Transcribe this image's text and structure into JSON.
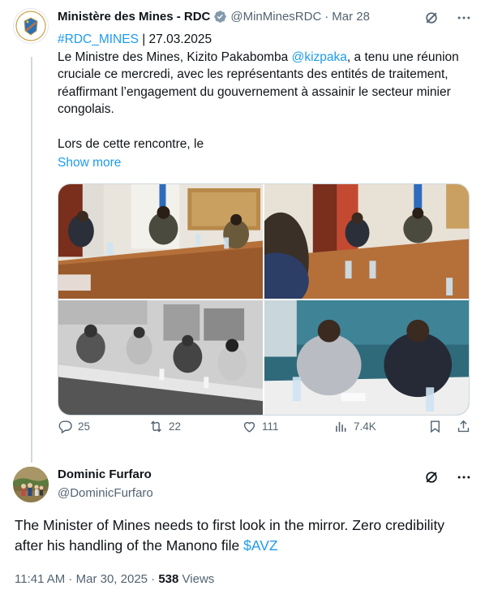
{
  "tweet": {
    "author_name": "Ministère des Mines - RDC",
    "author_handle": "@MinMinesRDC",
    "date": "Mar 28",
    "hashtag": "#RDC_MINES",
    "date_tag": " | 27.03.2025",
    "text_part1": "Le Ministre des Mines, Kizito Pakabomba ",
    "mention": "@kizpaka",
    "text_part2": ", a tenu une réunion cruciale ce mercredi, avec les représentants des entités de traitement, réaffirmant l’engagement du gouvernement à assainir le secteur minier congolais.",
    "text_part3": "Lors de cette rencontre, le",
    "show_more": "Show more",
    "stats": {
      "replies": "25",
      "reposts": "22",
      "likes": "111",
      "views": "7.4K"
    }
  },
  "reply": {
    "author_name": "Dominic Furfaro",
    "author_handle": "@DominicFurfaro",
    "text_main": "The Minister of Mines needs to first look in the mirror. Zero credibility after his handling of the Manono file ",
    "cashtag": "$AVZ",
    "time": "11:41 AM",
    "sep1": " · ",
    "date": "Mar 30, 2025",
    "sep2": " · ",
    "views_count": "538",
    "views_label": " Views"
  },
  "colors": {
    "link": "#1d9bf0",
    "secondary": "#536471",
    "verified": "#829aab"
  }
}
